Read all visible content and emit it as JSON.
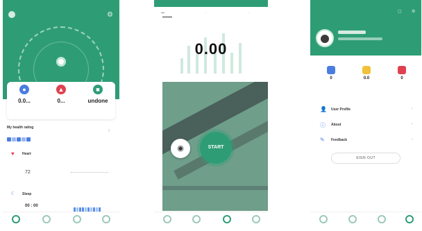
{
  "colors": {
    "brand_green": "#2e9d76",
    "heart_red": "#e0414f",
    "blue": "#4a7de0"
  },
  "phone1": {
    "stats": [
      {
        "icon": "drop-icon",
        "color": "#4a7de0",
        "value": "0.0..."
      },
      {
        "icon": "flame-icon",
        "color": "#e0414f",
        "value": "0..."
      },
      {
        "icon": "steps-icon",
        "color": "#2e9d76",
        "value": "undone"
      }
    ],
    "health_rating": {
      "title": "My health rating"
    },
    "heart_rate": {
      "label": "Heart",
      "value": "72"
    },
    "sleep": {
      "label": "Sleep",
      "value": "00 : 00"
    },
    "nav": [
      "",
      "",
      "",
      ""
    ]
  },
  "phone2": {
    "metric_value": "0.00",
    "start_label": "START",
    "camera_icon": "camera-icon"
  },
  "phone3": {
    "menu": [
      {
        "label": "User Profile",
        "icon": "user-icon"
      },
      {
        "label": "About",
        "icon": "info-icon"
      },
      {
        "label": "Feedback",
        "icon": "feedback-icon"
      }
    ],
    "signout_label": "SIGN OUT",
    "stats": [
      {
        "color": "#4a7de0",
        "value": "0"
      },
      {
        "color": "#f0c23c",
        "value": "0.0"
      },
      {
        "color": "#e0414f",
        "value": "0"
      }
    ]
  }
}
